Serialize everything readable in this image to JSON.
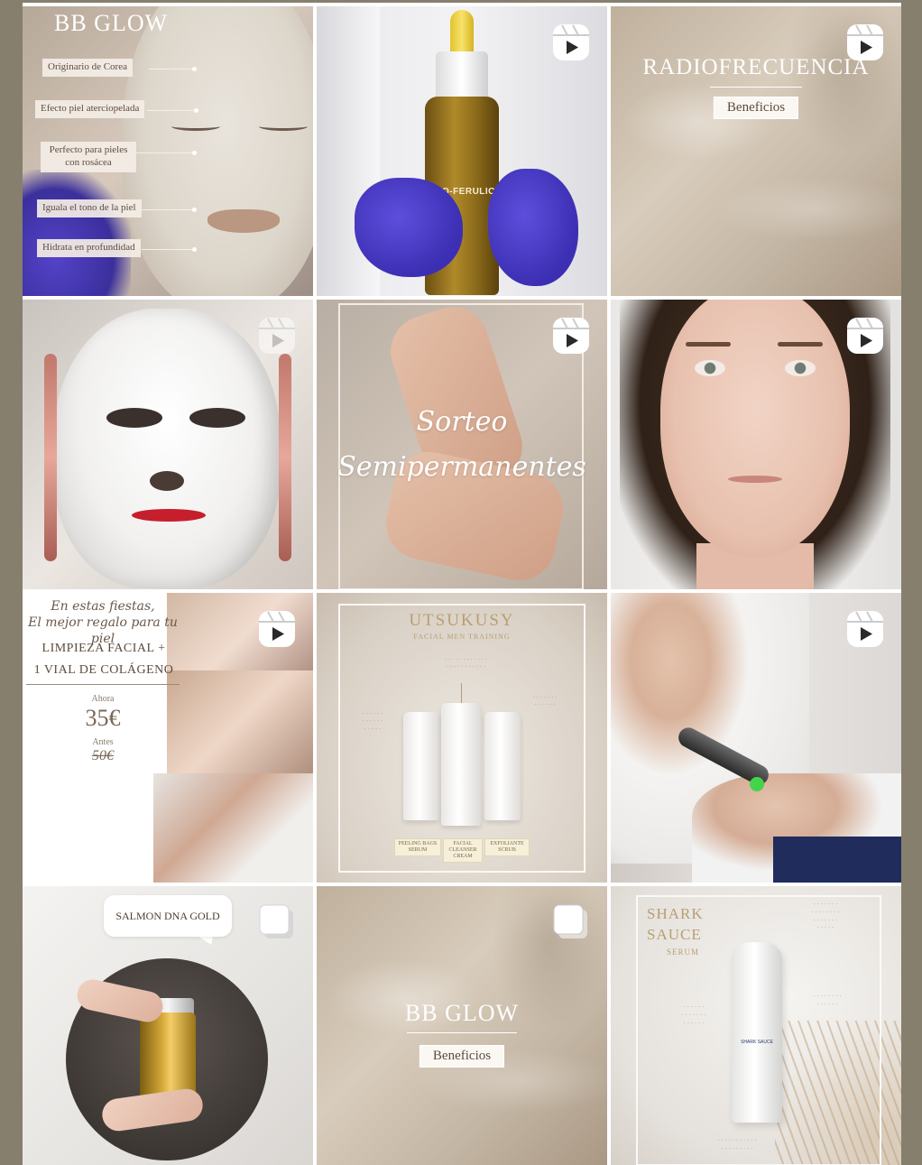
{
  "posts": [
    {
      "title": "BB GLOW",
      "tags": [
        "Originario de Corea",
        "Efecto piel aterciopelada",
        "Perfecto para pieles con rosácea",
        "Iguala el tono de la piel",
        "Hidrata en profundidad"
      ]
    },
    {
      "product_label": "ECO-FERULIC",
      "type_icon": "reel-icon"
    },
    {
      "title": "RADIOFRECUENCIA",
      "button": "Beneficios",
      "type_icon": "reel-icon"
    },
    {
      "type_icon": "reel-icon"
    },
    {
      "line1": "Sorteo",
      "line2": "Semipermanentes",
      "type_icon": "reel-icon"
    },
    {
      "type_icon": "reel-icon"
    },
    {
      "script_line1": "En estas fiestas,",
      "script_line2": "El mejor regalo para tu piel",
      "offer_line1": "LIMPIEZA FACIAL +",
      "offer_line2": "1 VIAL DE COLÁGENO",
      "now_label": "Ahora",
      "now_price": "35€",
      "before_label": "Antes",
      "before_price": "50€",
      "type_icon": "reel-icon"
    },
    {
      "brand": "UTSUKUSY",
      "subtitle": "FACIAL MEN TRAINING",
      "products": [
        "PEELING BAGS SERUM",
        "FACIAL CLEANSER CREAM",
        "EXFOLIANTE SCRUB"
      ]
    },
    {
      "type_icon": "reel-icon"
    },
    {
      "bubble": "SALMON DNA GOLD",
      "type_icon": "multi-icon"
    },
    {
      "title": "BB GLOW",
      "button": "Beneficios",
      "type_icon": "multi-icon"
    },
    {
      "title_line1": "SHARK",
      "title_line2": "SAUCE",
      "subtitle": "SERUM",
      "product_label": "SHARK SAUCE"
    }
  ]
}
